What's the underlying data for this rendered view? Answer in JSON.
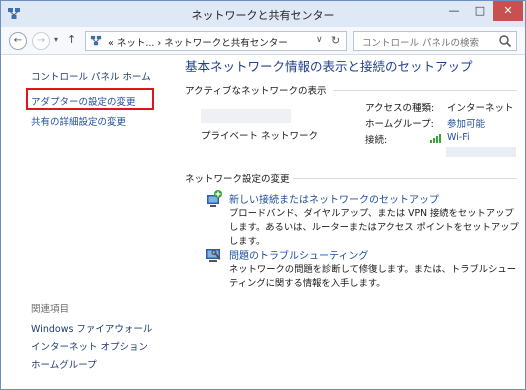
{
  "window": {
    "title": "ネットワークと共有センター",
    "min_label": "—",
    "max_label": "□",
    "close_label": "✕"
  },
  "nav": {
    "back": "←",
    "forward": "→",
    "dropdown": "▾",
    "up": "↑",
    "address": "« ネット... › ネットワークと共有センター",
    "address_dropdown": "∨",
    "refresh": "↻",
    "search_placeholder": "コントロール パネルの検索"
  },
  "left": {
    "home": "コントロール パネル ホーム",
    "adapter": "アダプターの設定の変更",
    "sharing": "共有の詳細設定の変更",
    "see_also": "関連項目",
    "firewall": "Windows ファイアウォール",
    "internet_options": "インターネット オプション",
    "homegroup": "ホームグループ"
  },
  "main": {
    "title": "基本ネットワーク情報の表示と接続のセットアップ",
    "active_networks": "アクティブなネットワークの表示",
    "network_type": "プライベート ネットワーク",
    "access_type_label": "アクセスの種類:",
    "access_type_value": "インターネット",
    "homegroup_label": "ホームグループ:",
    "homegroup_value": "参加可能",
    "connection_label": "接続:",
    "connection_value": "Wi-Fi",
    "change_settings": "ネットワーク設定の変更",
    "task1_link": "新しい接続またはネットワークのセットアップ",
    "task1_desc": "ブロードバンド、ダイヤルアップ、または VPN 接続をセットアップします。あるいは、ルーターまたはアクセス ポイントをセットアップします。",
    "task2_link": "問題のトラブルシューティング",
    "task2_desc": "ネットワークの問題を診断して修復します。または、トラブルシューティングに関する情報を入手します。"
  },
  "colors": {
    "highlight_border": "#e0141c",
    "link": "#1f4e9d",
    "title": "#1e3f8a"
  }
}
